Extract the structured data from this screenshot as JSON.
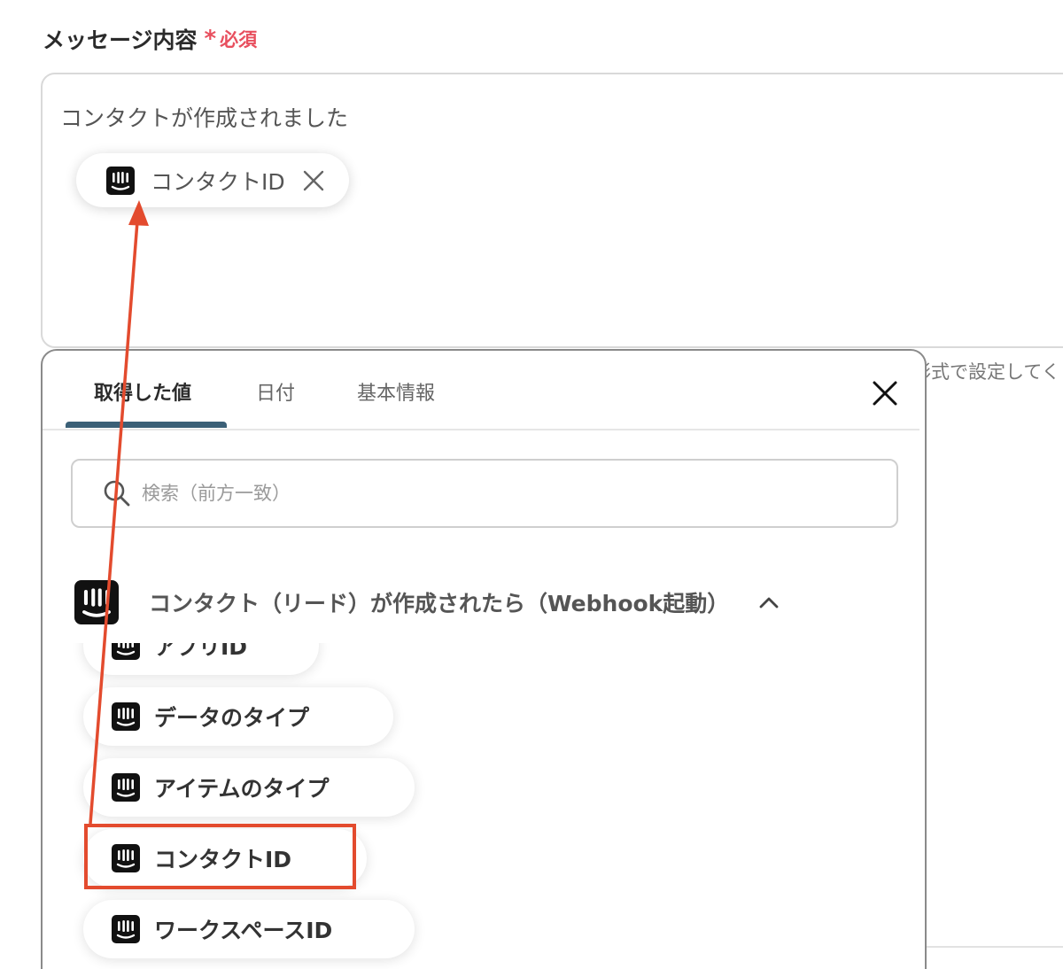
{
  "field": {
    "label": "メッセージ内容",
    "required_mark": "*",
    "required_text": "必須"
  },
  "message": {
    "text": "コンタクトが作成されました",
    "token_label": "コンタクトID"
  },
  "hint_text": "形式で設定してく",
  "popup": {
    "tabs": [
      {
        "label": "取得した値",
        "active": true
      },
      {
        "label": "日付",
        "active": false
      },
      {
        "label": "基本情報",
        "active": false
      }
    ],
    "search_placeholder": "検索（前方一致）",
    "group_title": "コンタクト（リード）が作成されたら（Webhook起動）",
    "items": [
      {
        "label": "アプリID"
      },
      {
        "label": "データのタイプ"
      },
      {
        "label": "アイテムのタイプ"
      },
      {
        "label": "コンタクトID",
        "highlighted": true
      },
      {
        "label": "ワークスペースID"
      }
    ]
  },
  "icons": {
    "app_icon": "intercom-icon",
    "close": "close-icon",
    "search": "search-icon",
    "chevron": "chevron-up-icon"
  },
  "colors": {
    "required": "#e84f5e",
    "tab_underline": "#3b6077",
    "annotation": "#e34b2e"
  }
}
